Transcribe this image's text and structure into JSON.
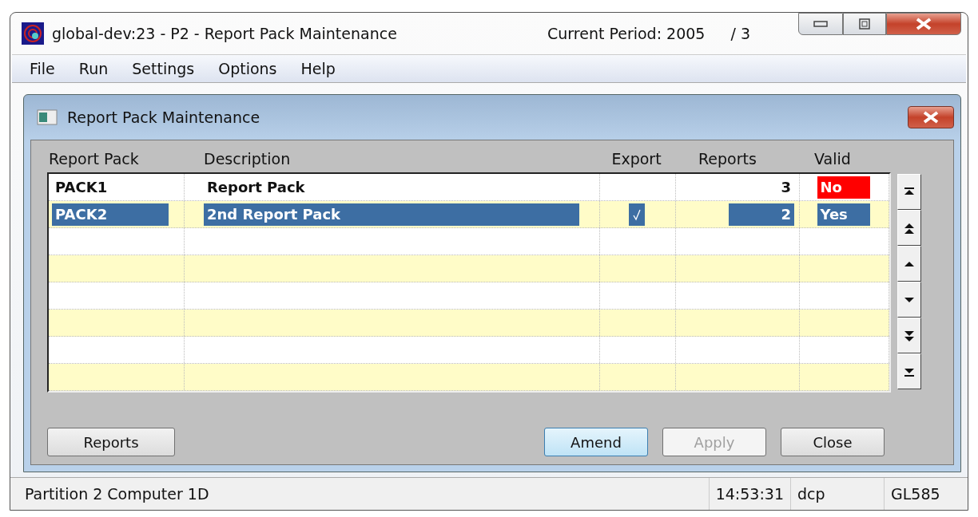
{
  "window": {
    "title": "global-dev:23 - P2 - Report Pack Maintenance",
    "period": "Current Period: 2005",
    "period_suffix": "/ 3"
  },
  "menu": [
    {
      "label": "File"
    },
    {
      "label": "Run"
    },
    {
      "label": "Settings"
    },
    {
      "label": "Options"
    },
    {
      "label": "Help"
    }
  ],
  "child_window": {
    "title": "Report Pack Maintenance"
  },
  "table": {
    "columns": [
      "Report Pack",
      "Description",
      "Export",
      "Reports",
      "Valid"
    ],
    "rows": [
      {
        "pack": "PACK1",
        "description": "Report Pack",
        "export": false,
        "reports": "3",
        "valid_text": "No",
        "valid": false,
        "selected": false
      },
      {
        "pack": "PACK2",
        "description": "2nd Report Pack",
        "export": true,
        "reports": "2",
        "valid_text": "Yes",
        "valid": true,
        "selected": true
      }
    ]
  },
  "buttons": [
    {
      "label": "Reports",
      "disabled": false,
      "default": false
    },
    {
      "label": "Amend",
      "disabled": false,
      "default": true
    },
    {
      "label": "Apply",
      "disabled": true,
      "default": false
    },
    {
      "label": "Close",
      "disabled": false,
      "default": false
    }
  ],
  "status_bar": {
    "message": "Partition 2 Computer 1D",
    "time": "14:53:31",
    "user": "dcp",
    "program": "GL585"
  }
}
